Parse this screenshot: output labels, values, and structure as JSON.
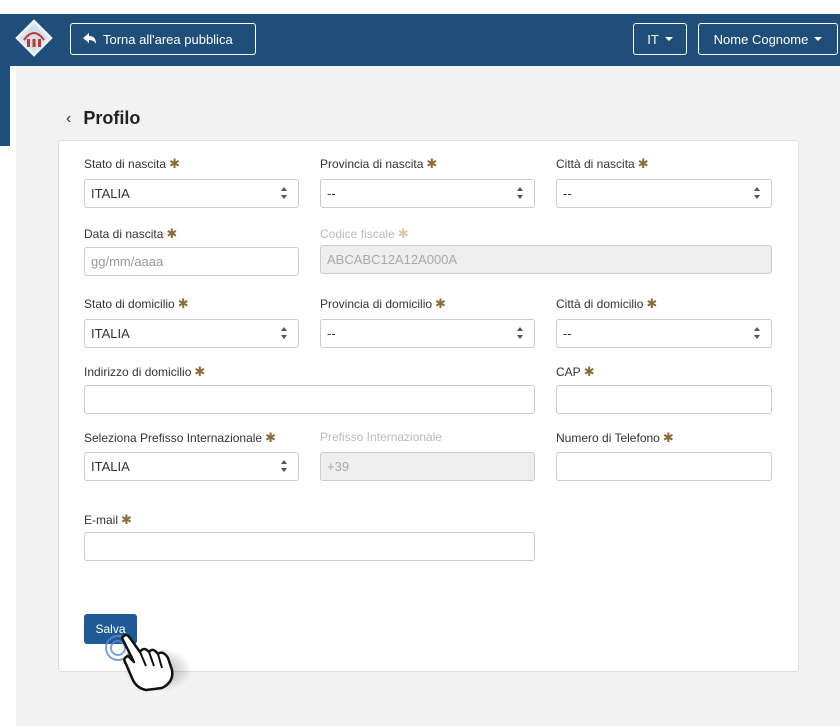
{
  "header": {
    "back_label": "Torna all'area pubblica",
    "lang_label": "IT",
    "user_label": "Nome Cognome"
  },
  "page": {
    "title": "Profilo"
  },
  "form": {
    "stato_nascita": {
      "label": "Stato di nascita",
      "value": "ITALIA"
    },
    "provincia_nascita": {
      "label": "Provincia di nascita",
      "value": "--"
    },
    "citta_nascita": {
      "label": "Città di nascita",
      "value": "--"
    },
    "data_nascita": {
      "label": "Data di nascita",
      "placeholder": "gg/mm/aaaa"
    },
    "codice_fiscale": {
      "label": "Codice fiscale",
      "value": "ABCABC12A12A000A"
    },
    "stato_domicilio": {
      "label": "Stato di domicilio",
      "value": "ITALIA"
    },
    "provincia_domicilio": {
      "label": "Provincia di domicilio",
      "value": "--"
    },
    "citta_domicilio": {
      "label": "Città di domicilio",
      "value": "--"
    },
    "indirizzo": {
      "label": "Indirizzo di domicilio",
      "value": ""
    },
    "cap": {
      "label": "CAP",
      "value": ""
    },
    "prefisso_sel": {
      "label": "Seleziona Prefisso Internazionale",
      "value": "ITALIA"
    },
    "prefisso": {
      "label": "Prefisso Internazionale",
      "value": "+39"
    },
    "telefono": {
      "label": "Numero di Telefono",
      "value": ""
    },
    "email": {
      "label": "E-mail",
      "value": ""
    },
    "required_mark": "✱",
    "save_label": "Salva"
  },
  "colors": {
    "header_bg": "#1f4e79",
    "required": "#8a6d3b",
    "save_bg": "#1f5a96"
  },
  "icons": [
    "logo-icon",
    "back-arrow-icon",
    "caret-down-icon",
    "chevron-left-icon",
    "select-arrows-icon",
    "hand-pointer-icon"
  ]
}
